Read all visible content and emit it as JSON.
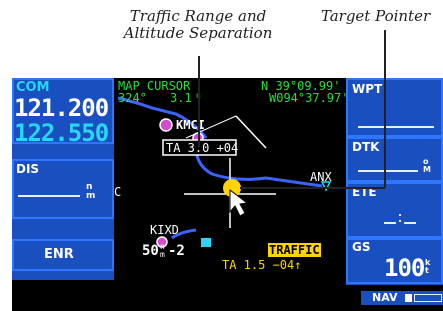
{
  "callouts": {
    "range_line1": "Traffic Range and",
    "range_line2": "Altitude Separation",
    "pointer": "Target Pointer"
  },
  "left_panel": {
    "com_label": "COM",
    "active_freq": "121.200",
    "standby_freq": "122.550",
    "dis_label": "DIS",
    "dis_unit": "n",
    "dis_unit2": "m",
    "mode": "ENR"
  },
  "map": {
    "header_title": "MAP CURSOR",
    "bearing": "324°",
    "distance": "3.1",
    "distance_unit": "n",
    "lat": "N 39°09.99'",
    "lon": "W094°37.97'",
    "airport_kmci": "KMCI",
    "airport_kixd": "KIXD",
    "vor_anx": "ANX",
    "traffic_tag": "TA 3.0 +04",
    "range_value": "50",
    "range_unit": "n",
    "range_unit2": "m",
    "zoom_marker": "-2",
    "left_partial": "C",
    "traffic_label": "TRAFFIC",
    "traffic_status": "TA 1.5 −04↑"
  },
  "right_panel": {
    "wpt_label": "WPT",
    "dtk_label": "DTK",
    "dtk_unit": "o",
    "dtk_unit2": "M",
    "ete_label": "ETE",
    "gs_label": "GS",
    "gs_value": "100",
    "gs_unit": "k",
    "gs_unit2": "t"
  },
  "bottom": {
    "nav_label": "NAV"
  },
  "colors": {
    "panel_blue": "#1a4fc0",
    "frame_blue": "#2f76ff",
    "cyan": "#28d7f5",
    "map_green": "#2bdc3b",
    "traffic_yellow": "#ffd400",
    "route_blue": "#3a64ff",
    "airport_magenta": "#d54bd0"
  }
}
